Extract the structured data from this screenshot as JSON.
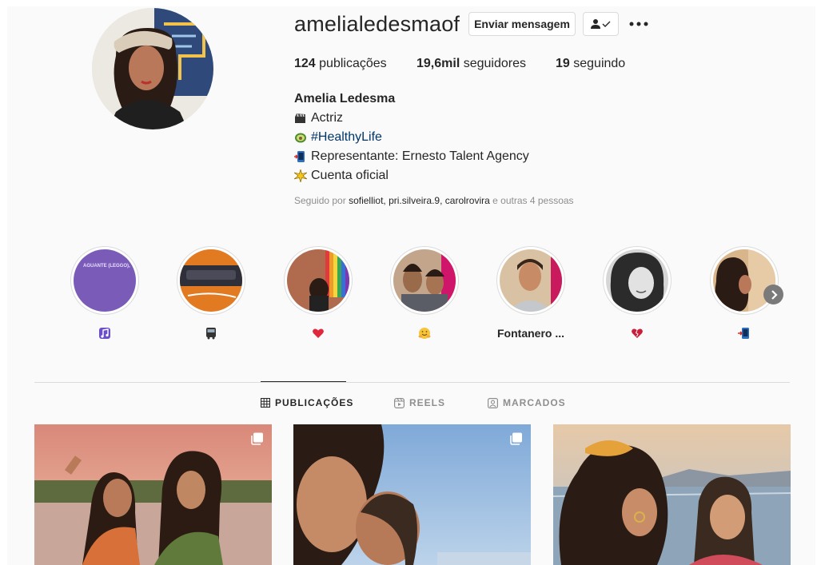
{
  "profile": {
    "username": "amelialedesmaof",
    "message_button": "Enviar mensagem",
    "stats": {
      "posts_count": "124",
      "posts_label": "publicações",
      "followers_count": "19,6mil",
      "followers_label": "seguidores",
      "following_count": "19",
      "following_label": "seguindo"
    },
    "bio": {
      "name": "Amelia Ledesma",
      "lines": [
        {
          "icon": "clapper-emoji",
          "text": "Actriz"
        },
        {
          "icon": "avocado-emoji",
          "text": "#HealthyLife"
        },
        {
          "icon": "phone-emoji",
          "text": "Representante: Ernesto Talent Agency"
        },
        {
          "icon": "sparkle-emoji",
          "text": "Cuenta oficial"
        }
      ]
    },
    "followed_by": {
      "prefix": "Seguido por",
      "names": "sofielliot, pri.silveira.9, carolrovira",
      "suffix": "e outras 4 pessoas"
    }
  },
  "highlights": [
    {
      "label": "",
      "icon": "music-emoji",
      "cover_text": "AGUANTE (LEGGO),"
    },
    {
      "label": "",
      "icon": "bus-emoji"
    },
    {
      "label": "",
      "icon": "heart-emoji"
    },
    {
      "label": "",
      "icon": "hug-emoji"
    },
    {
      "label": "Fontanero ...",
      "icon": ""
    },
    {
      "label": "",
      "icon": "heart-broken-emoji"
    },
    {
      "label": "",
      "icon": "phone-emoji"
    }
  ],
  "tabs": [
    {
      "label": "PUBLICAÇÕES",
      "icon": "grid-icon",
      "active": true
    },
    {
      "label": "REELS",
      "icon": "reels-icon",
      "active": false
    },
    {
      "label": "MARCADOS",
      "icon": "tagged-icon",
      "active": false
    }
  ],
  "colors": {
    "background": "#fafafa",
    "text": "#262626",
    "muted": "#8e8e8e",
    "link": "#00376b",
    "border": "#dbdbdb"
  }
}
